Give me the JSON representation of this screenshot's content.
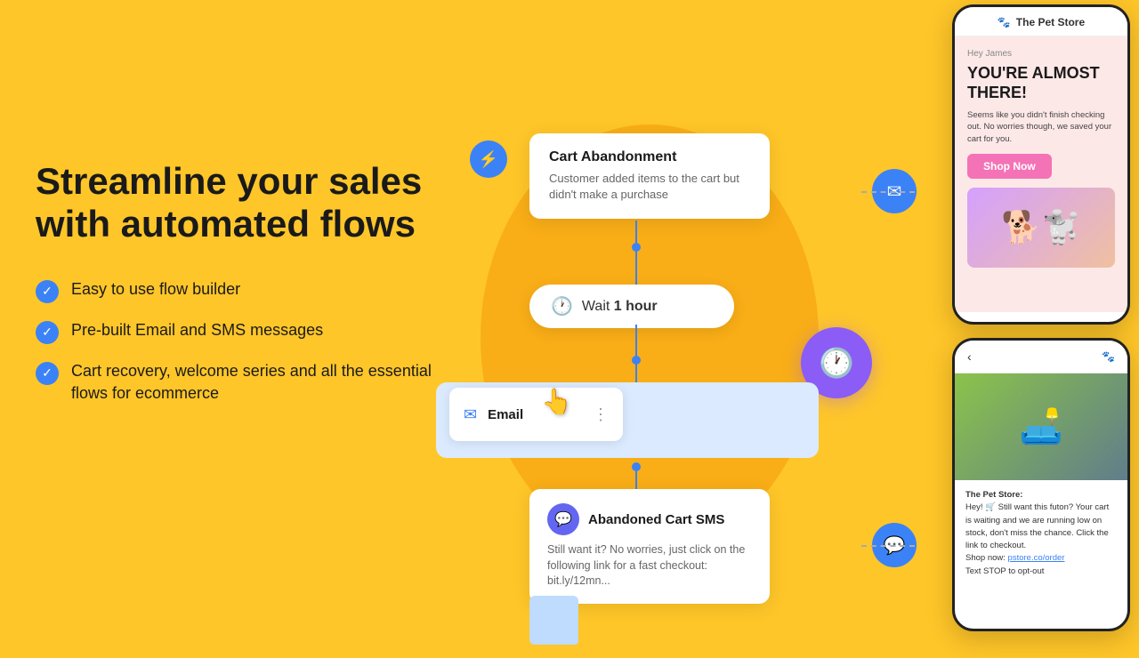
{
  "background_color": "#FFC629",
  "left": {
    "headline": "Streamline your sales with automated flows",
    "features": [
      "Easy to use flow builder",
      "Pre-built Email and SMS messages",
      "Cart recovery, welcome series and all the essential flows for ecommerce"
    ]
  },
  "flow": {
    "trigger": {
      "title": "Cart Abandonment",
      "description": "Customer added items to the cart but didn't make a purchase"
    },
    "wait": {
      "label": "Wait",
      "duration": "1 hour"
    },
    "email_step": {
      "label": "Email"
    },
    "sms": {
      "title": "Abandoned Cart SMS",
      "description": "Still want it? No worries, just click on the following link for a fast checkout: bit.ly/12mn..."
    }
  },
  "phone_top": {
    "store_name": "The Pet Store",
    "greeting": "Hey James",
    "headline": "YOU'RE ALMOST THERE!",
    "body": "Seems like you didn't finish checking out. No worries though, we saved your cart for you.",
    "button": "Shop Now"
  },
  "phone_bottom": {
    "store_name": "The Pet Store:",
    "message": "Hey! 🛒 Still want this futon? Your cart is waiting and we are running low on stock, don't miss the chance. Click the link to checkout.\nShop now: pstore.co/order\nText STOP to opt-out",
    "link_text": "pstore.co/order"
  },
  "icons": {
    "lightning": "⚡",
    "clock": "🕐",
    "email": "✉",
    "sms": "💬",
    "check": "✓",
    "paw": "🐾",
    "cursor": "👆"
  }
}
